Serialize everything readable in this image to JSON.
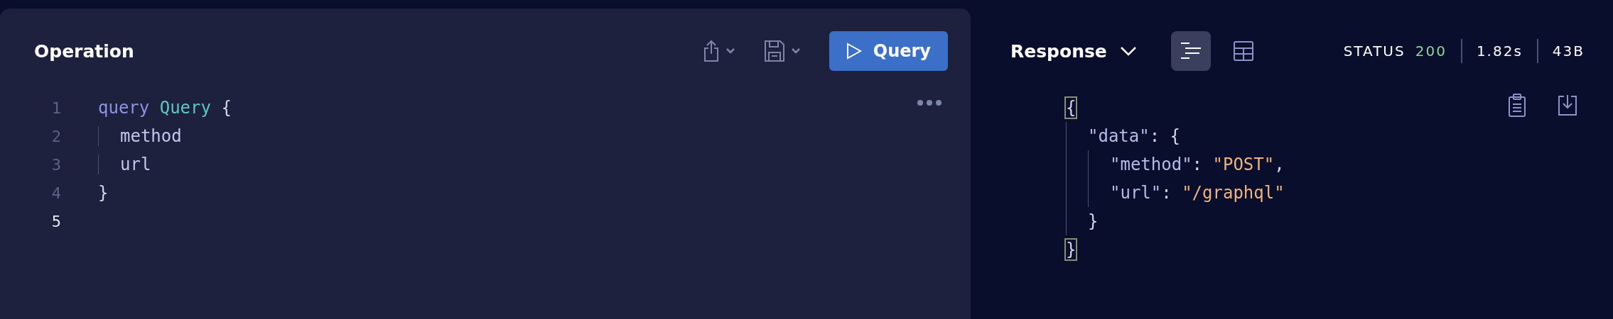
{
  "operation": {
    "title": "Operation",
    "run_button": "Query",
    "lines": [
      {
        "number": "1",
        "active": false,
        "guide": false,
        "tokens": [
          {
            "kind": "keyword",
            "text": "query"
          },
          {
            "kind": "name",
            "text": " Query"
          },
          {
            "kind": "punct",
            "text": " {"
          }
        ]
      },
      {
        "number": "2",
        "active": false,
        "guide": true,
        "tokens": [
          {
            "kind": "field",
            "text": "method"
          }
        ]
      },
      {
        "number": "3",
        "active": false,
        "guide": true,
        "tokens": [
          {
            "kind": "field",
            "text": "url"
          }
        ]
      },
      {
        "number": "4",
        "active": false,
        "guide": false,
        "tokens": [
          {
            "kind": "punct",
            "text": "}"
          }
        ]
      },
      {
        "number": "5",
        "active": true
      }
    ]
  },
  "response": {
    "title": "Response",
    "views": [
      {
        "kind": "text",
        "selected": true
      },
      {
        "kind": "table",
        "selected": false
      }
    ],
    "status_label": "STATUS",
    "status_code": "200",
    "time": "1.82s",
    "size": "43B",
    "json": {
      "tokens": [
        {
          "kind": "match",
          "text": "{"
        }
      ],
      "close": [
        {
          "kind": "match",
          "text": "}"
        }
      ],
      "children": [
        {
          "tokens": [
            {
              "kind": "key",
              "text": "\"data\""
            },
            {
              "kind": "punct",
              "text": ": {"
            }
          ],
          "close": [
            {
              "kind": "punct",
              "text": "}"
            }
          ],
          "children": [
            {
              "tokens": [
                {
                  "kind": "key",
                  "text": "\"method\""
                },
                {
                  "kind": "punct",
                  "text": ": "
                },
                {
                  "kind": "string",
                  "text": "\"POST\""
                },
                {
                  "kind": "punct",
                  "text": ","
                }
              ]
            },
            {
              "tokens": [
                {
                  "kind": "key",
                  "text": "\"url\""
                },
                {
                  "kind": "punct",
                  "text": ": "
                },
                {
                  "kind": "string",
                  "text": "\"/graphql\""
                }
              ]
            }
          ]
        }
      ]
    }
  }
}
